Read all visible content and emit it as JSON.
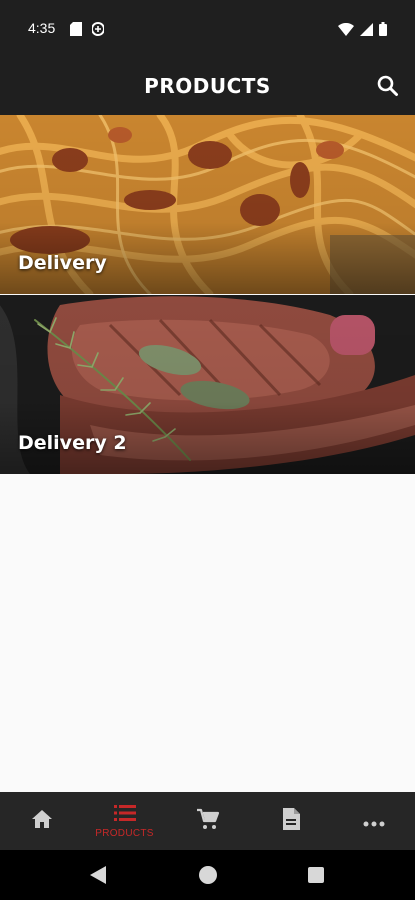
{
  "status_bar": {
    "time": "4:35",
    "left_icons": [
      "sim-card-icon",
      "data-saver-icon"
    ],
    "right_icons": [
      "wifi-icon",
      "signal-icon",
      "battery-icon"
    ]
  },
  "app_bar": {
    "title": "PRODUCTS",
    "search_icon": "search-icon"
  },
  "products": [
    {
      "label": "Delivery",
      "image": "pasta-photo"
    },
    {
      "label": "Delivery 2",
      "image": "steak-photo"
    }
  ],
  "bottom_nav": {
    "items": [
      {
        "icon": "home-icon",
        "label": ""
      },
      {
        "icon": "list-icon",
        "label": "PRODUCTS",
        "active": true
      },
      {
        "icon": "cart-icon",
        "label": ""
      },
      {
        "icon": "document-icon",
        "label": ""
      },
      {
        "icon": "more-icon",
        "label": ""
      }
    ]
  },
  "colors": {
    "bar_background": "#1f1f1f",
    "active_accent": "#c62828",
    "inactive_icon": "#cfcfcf",
    "content_background": "#fafafa"
  }
}
